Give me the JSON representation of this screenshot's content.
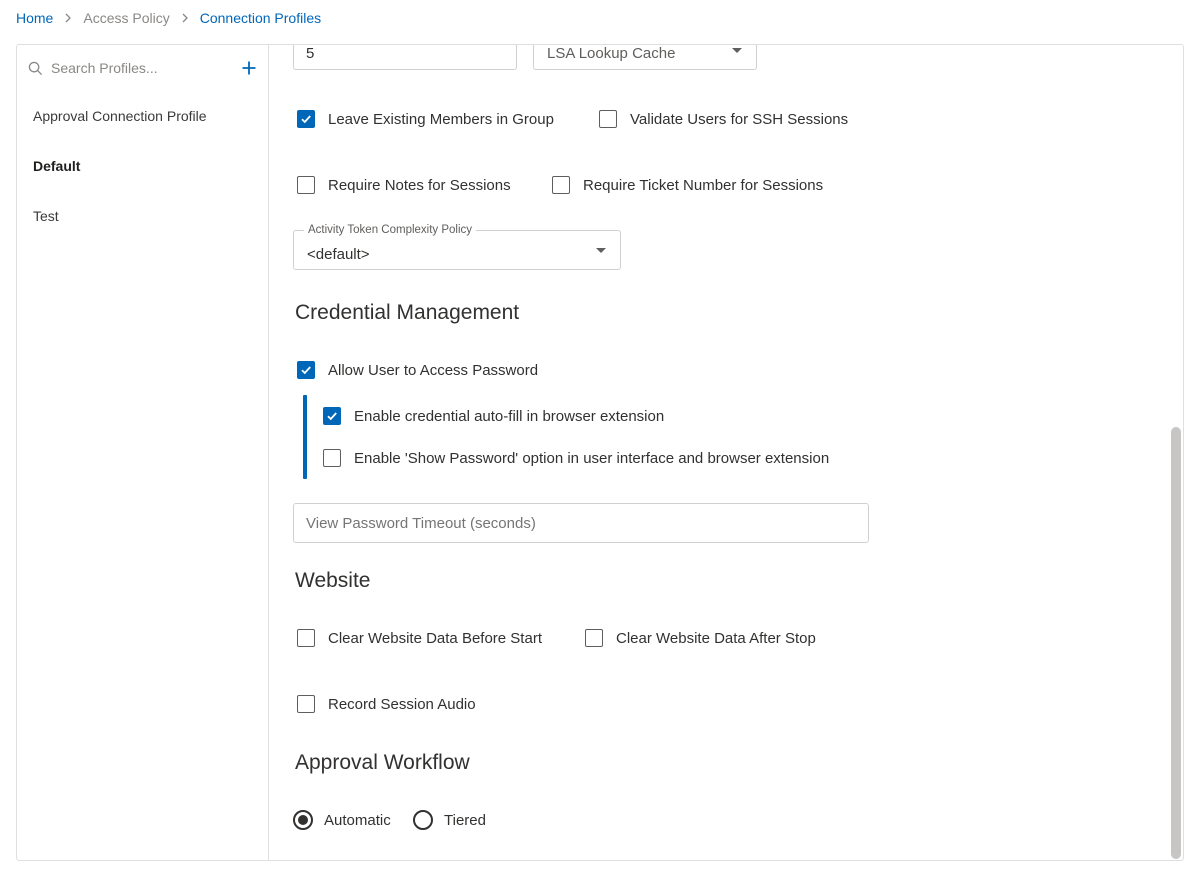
{
  "breadcrumb": {
    "home": "Home",
    "access_policy": "Access Policy",
    "current": "Connection Profiles"
  },
  "sidebar": {
    "search_placeholder": "Search Profiles...",
    "add_icon": "plus-icon",
    "search_icon": "search-icon",
    "items": [
      {
        "label": "Approval Connection Profile",
        "active": false
      },
      {
        "label": "Default",
        "active": true
      },
      {
        "label": "Test",
        "active": false
      }
    ]
  },
  "form": {
    "number_value": "5",
    "lsa_cache_select": "LSA Lookup Cache",
    "checkboxes_row1": {
      "leave_existing": {
        "label": "Leave Existing Members in Group",
        "checked": true
      },
      "validate_ssh": {
        "label": "Validate Users for SSH Sessions",
        "checked": false
      }
    },
    "checkboxes_row2": {
      "require_notes": {
        "label": "Require Notes for Sessions",
        "checked": false
      },
      "require_ticket": {
        "label": "Require Ticket Number for Sessions",
        "checked": false
      }
    },
    "activity_token": {
      "label": "Activity Token Complexity Policy",
      "value": "<default>"
    }
  },
  "credential_management": {
    "title": "Credential Management",
    "allow_access": {
      "label": "Allow User to Access Password",
      "checked": true
    },
    "autofill": {
      "label": "Enable credential auto-fill in browser extension",
      "checked": true
    },
    "show_password": {
      "label": "Enable 'Show Password' option in user interface and browser extension",
      "checked": false
    },
    "timeout_placeholder": "View Password Timeout (seconds)"
  },
  "website": {
    "title": "Website",
    "clear_before": {
      "label": "Clear Website Data Before Start",
      "checked": false
    },
    "clear_after": {
      "label": "Clear Website Data After Stop",
      "checked": false
    },
    "record_audio": {
      "label": "Record Session Audio",
      "checked": false
    }
  },
  "approval_workflow": {
    "title": "Approval Workflow",
    "options": [
      {
        "label": "Automatic",
        "selected": true
      },
      {
        "label": "Tiered",
        "selected": false
      }
    ]
  },
  "colors": {
    "accent": "#0067b8",
    "border": "#e1dfdd",
    "text": "#323130",
    "muted": "#8a8886"
  }
}
